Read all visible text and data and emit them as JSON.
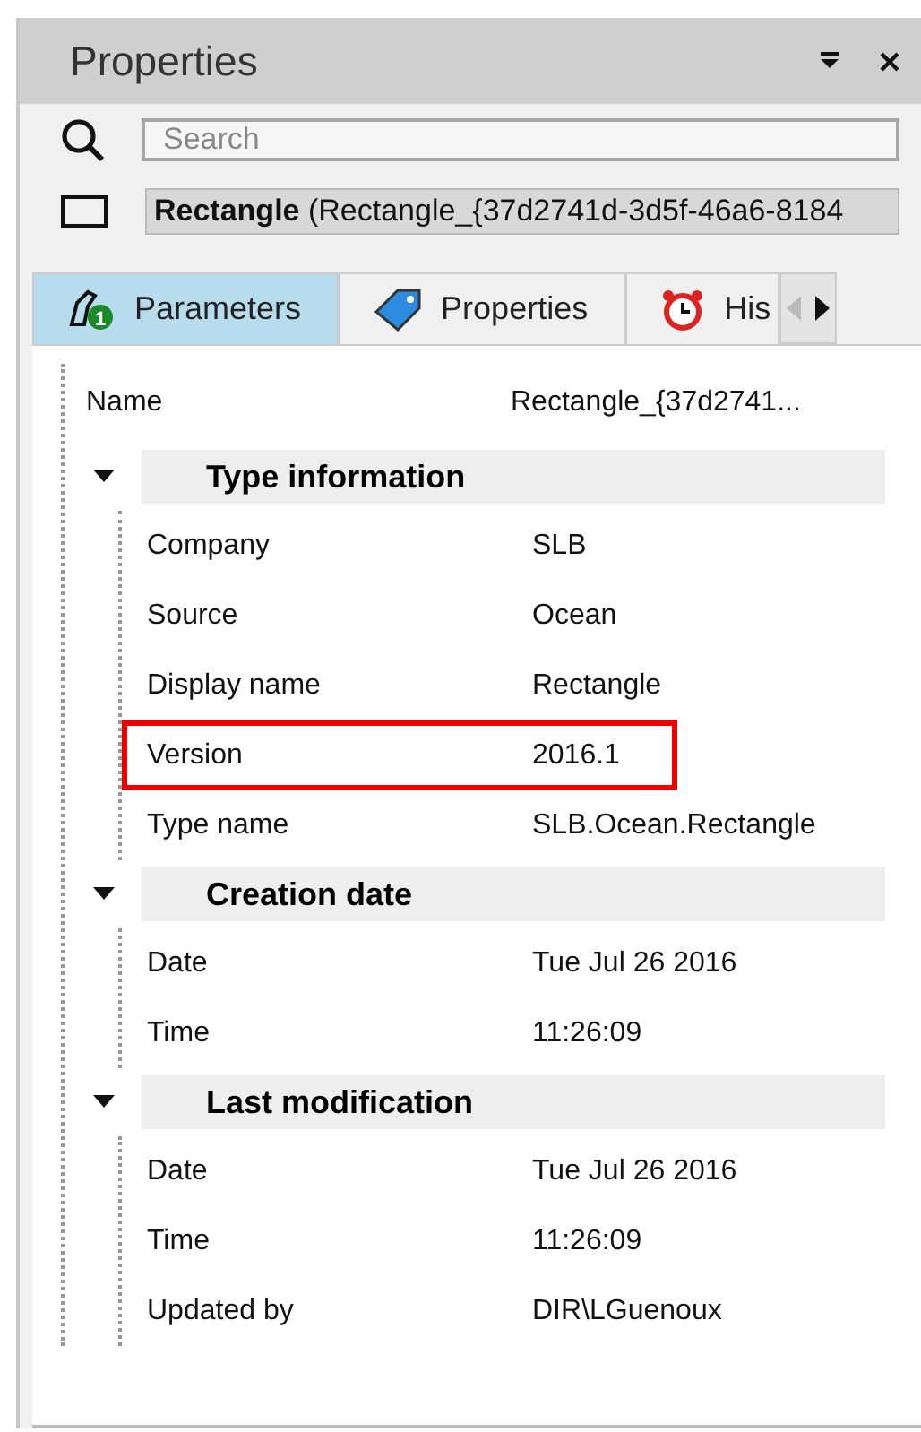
{
  "panel": {
    "title": "Properties"
  },
  "search": {
    "placeholder": "Search"
  },
  "object": {
    "label": "**Rectangle** (Rectangle_{37d2741d-3d5f-46a6-8184"
  },
  "tabs": [
    {
      "label": "Parameters",
      "kind": "parameters",
      "badge": "1",
      "selected": true
    },
    {
      "label": "Properties",
      "kind": "tag",
      "selected": false
    },
    {
      "label": "His",
      "kind": "history",
      "selected": false
    }
  ],
  "name_row": {
    "label": "Name",
    "value": "Rectangle_{37d2741..."
  },
  "sections": [
    {
      "title": "Type information",
      "expanded": true,
      "rows": [
        {
          "label": "Company",
          "value": "SLB",
          "highlighted": false
        },
        {
          "label": "Source",
          "value": "Ocean",
          "highlighted": false
        },
        {
          "label": "Display name",
          "value": "Rectangle",
          "highlighted": false
        },
        {
          "label": "Version",
          "value": "2016.1",
          "highlighted": true
        },
        {
          "label": "Type name",
          "value": "SLB.Ocean.Rectangle",
          "highlighted": false
        }
      ]
    },
    {
      "title": "Creation date",
      "expanded": true,
      "rows": [
        {
          "label": "Date",
          "value": "Tue Jul 26 2016",
          "highlighted": false
        },
        {
          "label": "Time",
          "value": "11:26:09",
          "highlighted": false
        }
      ]
    },
    {
      "title": "Last modification",
      "expanded": true,
      "rows": [
        {
          "label": "Date",
          "value": "Tue Jul 26 2016",
          "highlighted": false
        },
        {
          "label": "Time",
          "value": "11:26:09",
          "highlighted": false
        },
        {
          "label": "Updated by",
          "value": "DIR\\LGuenoux",
          "highlighted": false
        }
      ]
    }
  ]
}
